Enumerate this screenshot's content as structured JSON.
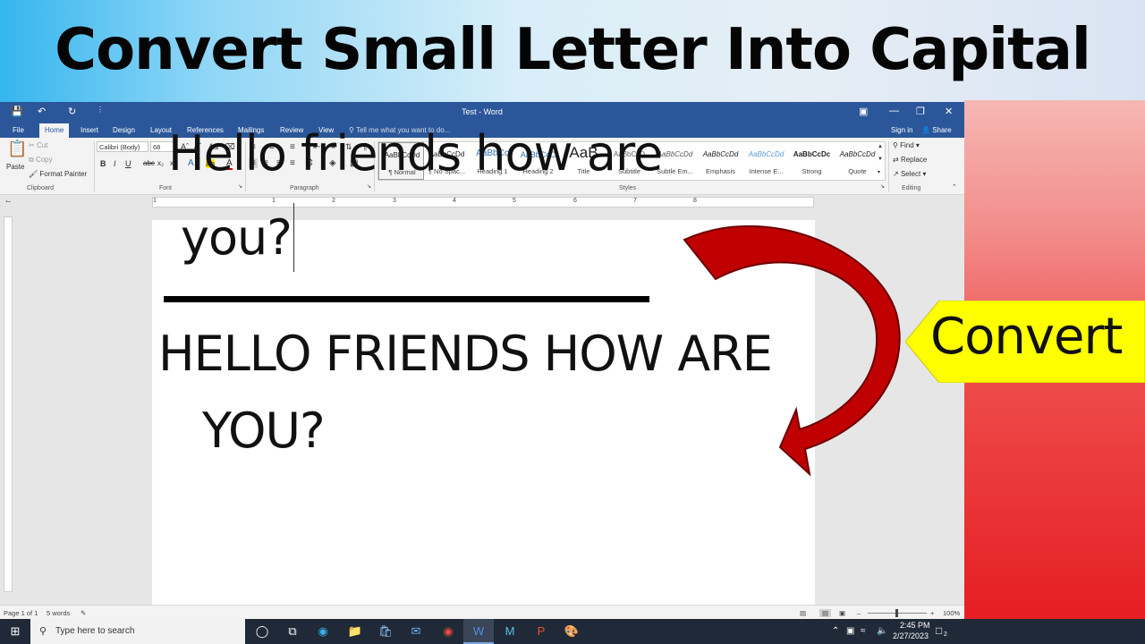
{
  "headline": "Convert Small Letter Into Capital",
  "callout": "Convert",
  "word": {
    "title": "Test - Word",
    "tabs": [
      "File",
      "Home",
      "Insert",
      "Design",
      "Layout",
      "References",
      "Mailings",
      "Review",
      "View"
    ],
    "tell_me": "Tell me what you want to do...",
    "sign_in": "Sign in",
    "share": "Share",
    "clipboard": {
      "paste": "Paste",
      "cut": "Cut",
      "copy": "Copy",
      "format_painter": "Format Painter",
      "label": "Clipboard"
    },
    "font": {
      "name": "Calibri (Body)",
      "size": "68",
      "label": "Font"
    },
    "paragraph_label": "Paragraph",
    "styles": [
      {
        "preview": "AaBbCcDd",
        "name": "¶ Normal"
      },
      {
        "preview": "AaBbCcDd",
        "name": "¶ No Spac..."
      },
      {
        "preview": "AaBbCc",
        "name": "Heading 1"
      },
      {
        "preview": "AaBbCcC",
        "name": "Heading 2"
      },
      {
        "preview": "AaB",
        "name": "Title"
      },
      {
        "preview": "AaBbCcD",
        "name": "Subtitle"
      },
      {
        "preview": "AaBbCcDd",
        "name": "Subtle Em..."
      },
      {
        "preview": "AaBbCcDd",
        "name": "Emphasis"
      },
      {
        "preview": "AaBbCcDd",
        "name": "Intense E..."
      },
      {
        "preview": "AaBbCcDc",
        "name": "Strong"
      },
      {
        "preview": "AaBbCcDd",
        "name": "Quote"
      }
    ],
    "styles_label": "Styles",
    "editing": {
      "find": "Find",
      "replace": "Replace",
      "select": "Select",
      "label": "Editing"
    },
    "document": {
      "line1": "Hello friends how are",
      "line2": "you?",
      "line3": "HELLO FRIENDS HOW ARE",
      "line4": "YOU?"
    },
    "status": {
      "page": "Page 1 of 1",
      "words": "5 words",
      "zoom": "100%"
    }
  },
  "ruler_numbers": [
    "1",
    "1",
    "2",
    "3",
    "4",
    "5",
    "6",
    "7",
    "8"
  ],
  "taskbar": {
    "search_placeholder": "Type here to search",
    "time": "2:45 PM",
    "date": "2/27/2023",
    "notifications": "2"
  }
}
